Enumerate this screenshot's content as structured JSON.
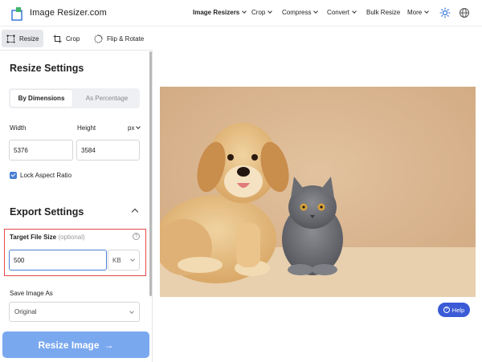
{
  "header": {
    "logo_text": "Image Resizer.com",
    "nav": [
      {
        "label": "Image Resizers",
        "dropdown": true,
        "bold": true
      },
      {
        "label": "Crop",
        "dropdown": true
      },
      {
        "label": "Compress",
        "dropdown": true
      },
      {
        "label": "Convert",
        "dropdown": true
      },
      {
        "label": "Bulk Resize",
        "dropdown": false
      },
      {
        "label": "More",
        "dropdown": true
      }
    ],
    "icons": [
      "sun-icon",
      "globe-icon"
    ]
  },
  "tools": {
    "resize": "Resize",
    "crop": "Crop",
    "flip_rotate": "Flip & Rotate",
    "active": "resize"
  },
  "resize_settings": {
    "title": "Resize Settings",
    "mode_dimensions": "By Dimensions",
    "mode_percentage": "As Percentage",
    "active_mode": "By Dimensions",
    "width_label": "Width",
    "height_label": "Height",
    "unit": "px",
    "width_value": "5376",
    "height_value": "3584",
    "lock_label": "Lock Aspect Ratio",
    "lock_checked": true
  },
  "export_settings": {
    "title": "Export Settings",
    "target_label": "Target File Size",
    "target_optional": "(optional)",
    "target_value": "500",
    "target_unit": "KB",
    "save_as_label": "Save Image As",
    "save_as_value": "Original"
  },
  "action": {
    "resize_button": "Resize Image",
    "arrow": "→"
  },
  "help": {
    "label": "Help"
  },
  "colors": {
    "accent": "#4a7fd4",
    "button": "#7aa8ef",
    "highlight_border": "#e24a4a",
    "help_button": "#3b5bd6"
  }
}
